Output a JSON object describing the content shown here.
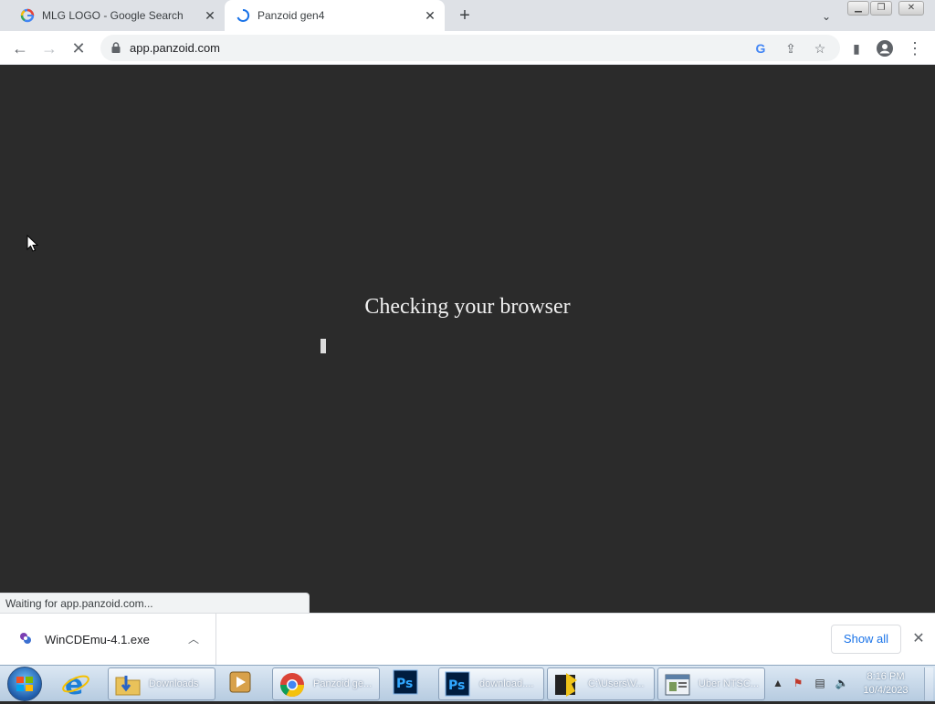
{
  "browser": {
    "tabs": [
      {
        "title": "MLG LOGO - Google Search",
        "favicon": "google-g-icon"
      },
      {
        "title": "Panzoid gen4",
        "favicon": "loading-spinner-icon",
        "active": true
      }
    ],
    "url": "app.panzoid.com"
  },
  "page": {
    "heading": "Checking your browser",
    "status_text": "Waiting for app.panzoid.com..."
  },
  "downloads": {
    "file_name": "WinCDEmu-4.1.exe",
    "show_all_label": "Show all"
  },
  "taskbar": {
    "apps": [
      {
        "label": "Downloads",
        "icon": "folder-icon"
      },
      {
        "label": "Panzoid ge...",
        "icon": "chrome-icon"
      },
      {
        "label": "download....",
        "icon": "photoshop-icon"
      },
      {
        "label": "C:\\Users\\V...",
        "icon": "console-icon"
      },
      {
        "label": "Uber NTSC...",
        "icon": "window-icon"
      }
    ],
    "time": "8:16 PM",
    "date": "10/4/2023"
  },
  "colors": {
    "page_bg": "#2b2b2b",
    "accent": "#1a73e8"
  }
}
